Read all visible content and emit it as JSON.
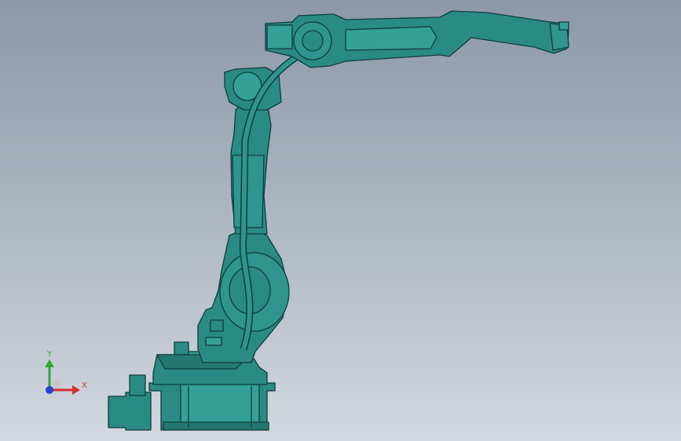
{
  "viewport": {
    "model_color": "#2a8a84",
    "model_dark": "#0f3e3b",
    "model_light": "#46b0a8"
  },
  "triad": {
    "x_label": "X",
    "y_label": "Y",
    "x_color": "#d43030",
    "y_color": "#2fa82f",
    "z_color": "#2a3fd0"
  }
}
